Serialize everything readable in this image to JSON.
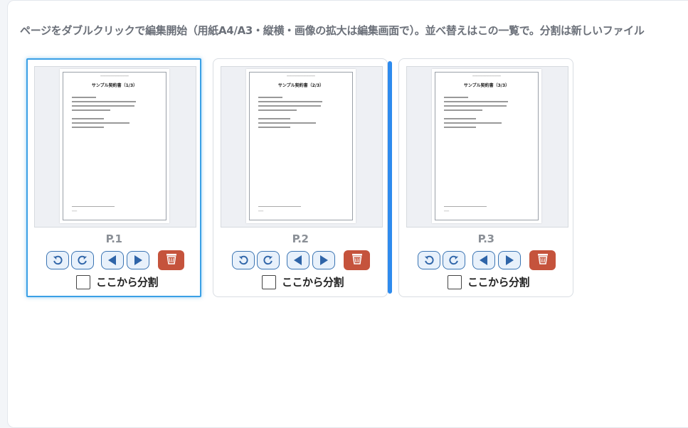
{
  "instruction": "ページをダブルクリックで編集開始（用紙A4/A3・縦横・画像の拡大は編集画面で）。並べ替えはこの一覧で。分割は新しいファイル",
  "pages": [
    {
      "label": "P.1",
      "doc_title": "サンプル契約書（1/3）",
      "split_label": "ここから分割",
      "selected": true
    },
    {
      "label": "P.2",
      "doc_title": "サンプル契約書（2/3）",
      "split_label": "ここから分割",
      "selected": false
    },
    {
      "label": "P.3",
      "doc_title": "サンプル契約書（3/3）",
      "split_label": "ここから分割",
      "selected": false
    }
  ],
  "icons": {
    "rotate_left": "rotate-left-icon",
    "rotate_right": "rotate-right-icon",
    "move_left": "triangle-left-icon",
    "move_right": "triangle-right-icon",
    "delete": "trash-icon"
  },
  "colors": {
    "accent": "#2e8bee",
    "button_border": "#3a74b3",
    "delete": "#c5533c",
    "selected_border": "#3aa0e6"
  }
}
